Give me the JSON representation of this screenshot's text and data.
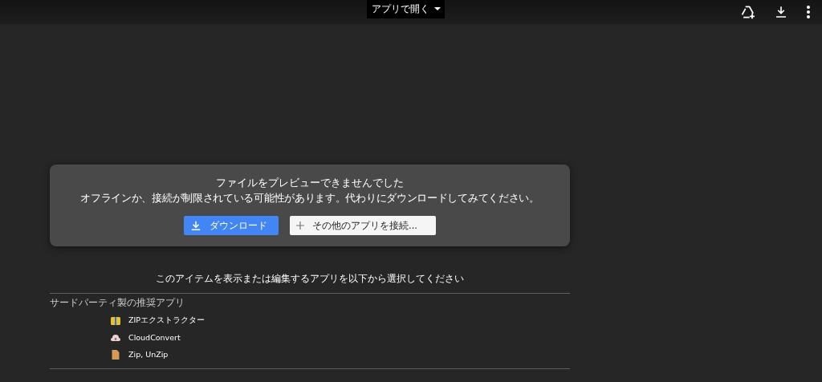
{
  "top_bar": {
    "open_with": "アプリで開く"
  },
  "error_card": {
    "title": "ファイルをプレビューできませんでした",
    "message": "オフラインか、接続が制限されている可能性があります。代わりにダウンロードしてみてください。",
    "download_button": "ダウンロード",
    "connect_button": "その他のアプリを接続..."
  },
  "apps_prompt": "このアイテムを表示または編集するアプリを以下から選択してください",
  "apps_section": {
    "heading": "サードパーティ製の推奨アプリ",
    "apps": [
      {
        "name": "ZIPエクストラクター",
        "kind": "archive"
      },
      {
        "name": "CloudConvert",
        "kind": "cloud"
      },
      {
        "name": "Zip, UnZip",
        "kind": "file"
      }
    ]
  }
}
